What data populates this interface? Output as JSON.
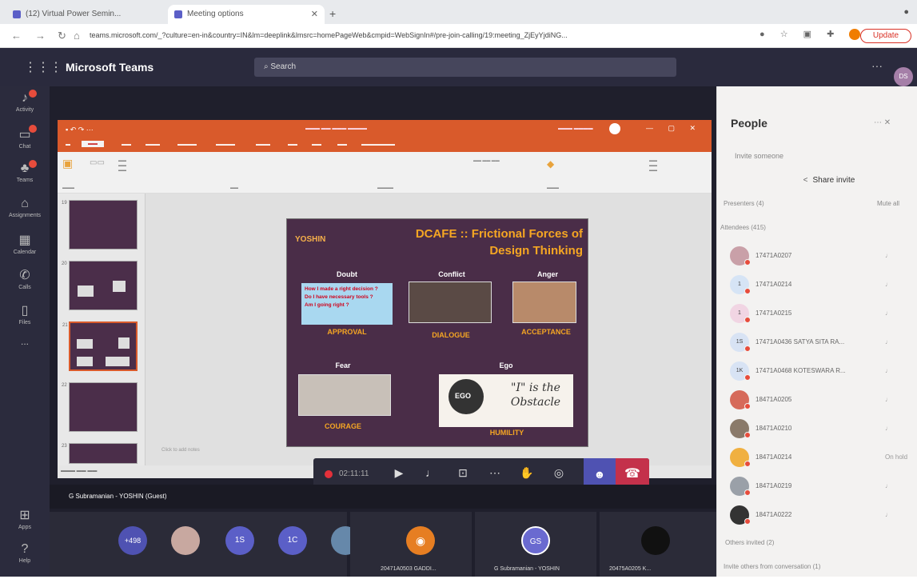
{
  "browser": {
    "tabs": [
      {
        "label": "(12) Virtual Power Semin..."
      },
      {
        "label": "Meeting options"
      }
    ],
    "url": "teams.microsoft.com/_?culture=en-in&country=IN&lm=deeplink&lmsrc=homePageWeb&cmpid=WebSignIn#/pre-join-calling/19:meeting_ZjEyYjdiNG...",
    "update_label": "Update"
  },
  "teams": {
    "app_title": "Microsoft Teams",
    "search_placeholder": "Search",
    "user_initials": "DS",
    "rail": [
      {
        "label": "Activity",
        "icon": "bell-icon",
        "badge": true
      },
      {
        "label": "Chat",
        "icon": "chat-icon",
        "badge": true
      },
      {
        "label": "Teams",
        "icon": "teams-icon",
        "badge": true
      },
      {
        "label": "Assignments",
        "icon": "assignments-icon",
        "badge": false
      },
      {
        "label": "Calendar",
        "icon": "calendar-icon",
        "badge": false
      },
      {
        "label": "Calls",
        "icon": "phone-icon",
        "badge": false
      },
      {
        "label": "Files",
        "icon": "file-icon",
        "badge": false
      },
      {
        "label": "...",
        "icon": "more-icon",
        "badge": false
      }
    ],
    "rail_bottom": [
      {
        "label": "Apps",
        "icon": "apps-icon"
      },
      {
        "label": "Help",
        "icon": "help-icon"
      }
    ]
  },
  "slide": {
    "brand": "YOSHIN",
    "title_line1": "DCAFE :: Frictional Forces of",
    "title_line2": "Design Thinking",
    "doubt_label": "Doubt",
    "doubt_lines": [
      "How I made a right decision ?",
      "Do I have necessary tools ?",
      "Am I going right ?"
    ],
    "conflict_label": "Conflict",
    "anger_label": "Anger",
    "approval": "APPROVAL",
    "dialogue": "DIALOGUE",
    "acceptance": "ACCEPTANCE",
    "fear_label": "Fear",
    "ego_label": "Ego",
    "ego_ball": "EGO",
    "ego_text": "\"I\" is the Obstacle",
    "courage": "COURAGE",
    "humility": "HUMILITY"
  },
  "ppt": {
    "notes_placeholder": "Click to add notes"
  },
  "call": {
    "timer": "02:11:11",
    "presenter_name": "G Subramanian - YOSHIN (Guest)",
    "overflow_count": "+498",
    "tiles": [
      {
        "initials": "",
        "name": ""
      },
      {
        "initials": "1S",
        "name": ""
      },
      {
        "initials": "1C",
        "name": ""
      }
    ],
    "big_tiles": [
      {
        "initials": "",
        "name": "20471A0503 GADDI..."
      },
      {
        "initials": "GS",
        "name": "G Subramanian - YOSHIN"
      },
      {
        "initials": "",
        "name": "20475A0205 K..."
      }
    ]
  },
  "people": {
    "title": "People",
    "invite_placeholder": "Invite someone",
    "share_invite": "Share invite",
    "presenters": "Presenters (4)",
    "mute_all": "Mute all",
    "attendees": "Attendees (415)",
    "list": [
      {
        "name": "17471A0207",
        "initials": "",
        "status": "",
        "color": "#c9a0a8"
      },
      {
        "name": "17471A0214",
        "initials": "1",
        "status": "",
        "color": "#d6e4f5"
      },
      {
        "name": "17471A0215",
        "initials": "1",
        "status": "",
        "color": "#f1d5e3"
      },
      {
        "name": "17471A0436 SATYA SITA RA...",
        "initials": "1S",
        "status": "",
        "color": "#d8e3f4"
      },
      {
        "name": "17471A0468 KOTESWARA R...",
        "initials": "1K",
        "status": "",
        "color": "#d8e3f4"
      },
      {
        "name": "18471A0205",
        "initials": "",
        "status": "",
        "color": "#d66a5a"
      },
      {
        "name": "18471A0210",
        "initials": "",
        "status": "",
        "color": "#8a7a6a"
      },
      {
        "name": "18471A0214",
        "initials": "",
        "status": "On hold",
        "color": "#f0b040"
      },
      {
        "name": "18471A0219",
        "initials": "",
        "status": "",
        "color": "#9aa0a8"
      },
      {
        "name": "18471A0222",
        "initials": "",
        "status": "",
        "color": "#333333"
      }
    ],
    "others_invited": "Others invited (2)",
    "invite_others": "Invite others from conversation (1)"
  }
}
